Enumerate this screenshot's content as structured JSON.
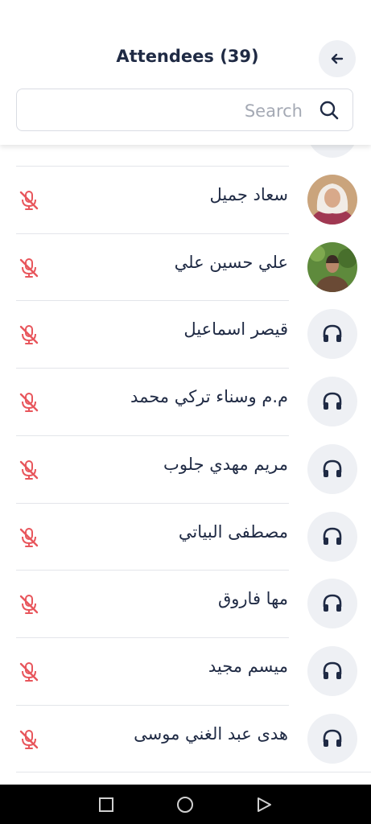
{
  "header": {
    "title": "Attendees (39)",
    "back_icon": "arrow-left-icon"
  },
  "search": {
    "placeholder": "Search",
    "icon": "search-icon"
  },
  "colors": {
    "text": "#1f2a44",
    "muted_mic": "#e8565c",
    "avatar_bg": "#eef0f4",
    "status_dot": "#2ecc71"
  },
  "attendees": [
    {
      "name": "سعاد جميل",
      "avatar": "photo",
      "mic": "mic-muted-icon"
    },
    {
      "name": "علي حسين علي",
      "avatar": "photo",
      "mic": "mic-muted-icon"
    },
    {
      "name": "قيصر اسماعيل",
      "avatar": "headphones-icon",
      "mic": "mic-muted-icon"
    },
    {
      "name": "م.م وسناء تركي محمد",
      "avatar": "headphones-icon",
      "mic": "mic-muted-icon"
    },
    {
      "name": "مريم مهدي جلوب",
      "avatar": "headphones-icon",
      "mic": "mic-muted-icon"
    },
    {
      "name": "مصطفى البياتي",
      "avatar": "headphones-icon",
      "mic": "mic-muted-icon"
    },
    {
      "name": "مها فاروق",
      "avatar": "headphones-icon",
      "mic": "mic-muted-icon"
    },
    {
      "name": "ميسم مجيد",
      "avatar": "headphones-icon",
      "mic": "mic-muted-icon"
    },
    {
      "name": "هدى عبد الغني موسى",
      "avatar": "headphones-icon",
      "mic": "mic-muted-icon"
    }
  ],
  "navbar": {
    "recent_icon": "square-icon",
    "home_icon": "circle-icon",
    "back_icon": "triangle-back-icon"
  }
}
